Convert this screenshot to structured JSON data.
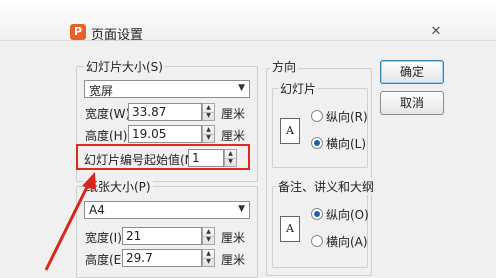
{
  "window": {
    "title": "页面设置",
    "app_icon_letter": "P",
    "close_label": "✕"
  },
  "slide_size": {
    "group_label": "幻灯片大小(S)",
    "preset": "宽屏",
    "width_label": "宽度(W):",
    "width_value": "33.87",
    "height_label": "高度(H):",
    "height_value": "19.05",
    "unit": "厘米",
    "start_number_label": "幻灯片编号起始值(N):",
    "start_number_value": "1"
  },
  "paper_size": {
    "group_label": "纸张大小(P)",
    "preset": "A4",
    "width_label": "宽度(I):",
    "width_value": "21",
    "height_label": "高度(E):",
    "height_value": "29.7",
    "unit": "厘米"
  },
  "orientation": {
    "group_label": "方向",
    "slides_label": "幻灯片",
    "slides_options": [
      "纵向(R)",
      "横向(L)"
    ],
    "slides_selected": 1,
    "notes_label": "备注、讲义和大纲",
    "notes_options": [
      "纵向(O)",
      "横向(A)"
    ],
    "notes_selected": 0,
    "page_icon_letter": "A"
  },
  "buttons": {
    "ok": "确定",
    "cancel": "取消"
  },
  "annotation": {
    "highlight_color": "#e02a1e",
    "arrow_color": "#d8261c"
  }
}
